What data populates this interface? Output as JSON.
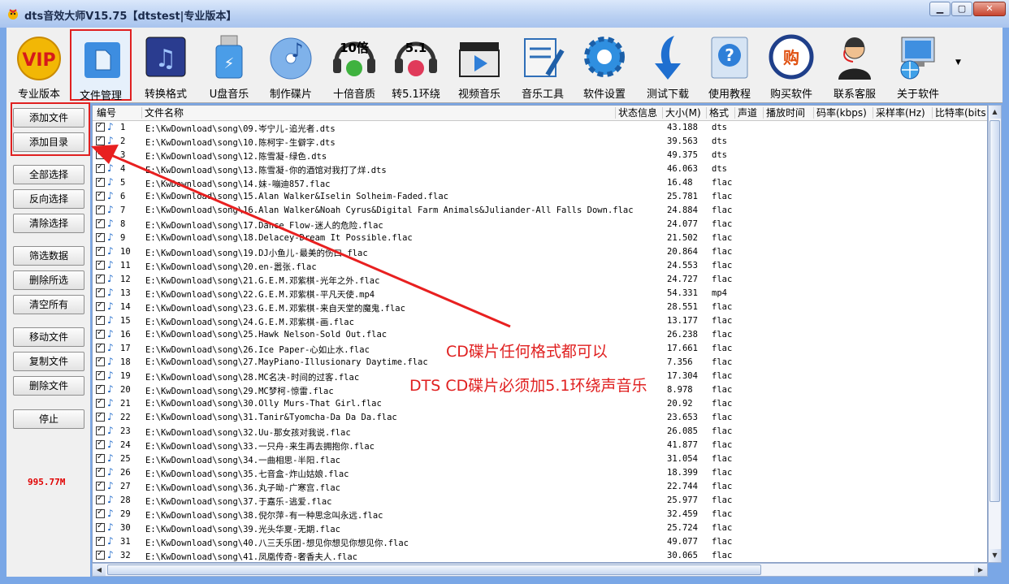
{
  "window": {
    "title": "dts音效大师V15.75【dtstest|专业版本】",
    "min_glyph": "▁",
    "max_glyph": "▢",
    "close_glyph": "✕"
  },
  "toolbar": {
    "items": [
      {
        "label": "专业版本",
        "icon": "vip-icon"
      },
      {
        "label": "文件管理",
        "icon": "file-manage-icon",
        "active": true
      },
      {
        "label": "转换格式",
        "icon": "convert-icon"
      },
      {
        "label": "U盘音乐",
        "icon": "usb-icon"
      },
      {
        "label": "制作碟片",
        "icon": "disc-icon"
      },
      {
        "label": "十倍音质",
        "icon": "ten-x-icon",
        "badge": "10倍"
      },
      {
        "label": "转5.1环绕",
        "icon": "surround-icon",
        "badge": "5.1"
      },
      {
        "label": "视频音乐",
        "icon": "video-icon"
      },
      {
        "label": "音乐工具",
        "icon": "tools-icon"
      },
      {
        "label": "软件设置",
        "icon": "gear-icon"
      },
      {
        "label": "测试下载",
        "icon": "download-icon"
      },
      {
        "label": "使用教程",
        "icon": "help-icon"
      },
      {
        "label": "购买软件",
        "icon": "buy-icon",
        "badge": "购"
      },
      {
        "label": "联系客服",
        "icon": "support-icon"
      },
      {
        "label": "关于软件",
        "icon": "about-icon"
      }
    ],
    "more_glyph": "▼"
  },
  "sidebar": {
    "buttons": [
      "添加文件",
      "添加目录",
      "全部选择",
      "反向选择",
      "清除选择",
      "筛选数据",
      "删除所选",
      "清空所有",
      "移动文件",
      "复制文件",
      "删除文件",
      "停止"
    ],
    "speed": "995.77M"
  },
  "table": {
    "columns": [
      "编号",
      "文件名称",
      "状态信息",
      "大小(M)",
      "格式",
      "声道",
      "播放时间",
      "码率(kbps)",
      "采样率(Hz)",
      "比特率(bits"
    ],
    "rows": [
      {
        "n": "1",
        "path": "E:\\KwDownload\\song\\09.岑宁儿-追光者.dts",
        "size": "43.188",
        "fmt": "dts"
      },
      {
        "n": "2",
        "path": "E:\\KwDownload\\song\\10.陈柯宇-生僻字.dts",
        "size": "39.563",
        "fmt": "dts"
      },
      {
        "n": "3",
        "path": "E:\\KwDownload\\song\\12.陈雪凝-绿色.dts",
        "size": "49.375",
        "fmt": "dts"
      },
      {
        "n": "4",
        "path": "E:\\KwDownload\\song\\13.陈雪凝-你的酒馆对我打了烊.dts",
        "size": "46.063",
        "fmt": "dts"
      },
      {
        "n": "5",
        "path": "E:\\KwDownload\\song\\14.妹-嘣迪857.flac",
        "size": "16.48",
        "fmt": "flac"
      },
      {
        "n": "6",
        "path": "E:\\KwDownload\\song\\15.Alan Walker&Iselin Solheim-Faded.flac",
        "size": "25.781",
        "fmt": "flac"
      },
      {
        "n": "7",
        "path": "E:\\KwDownload\\song\\16.Alan Walker&Noah Cyrus&Digital Farm Animals&Juliander-All Falls Down.flac",
        "size": "24.884",
        "fmt": "flac"
      },
      {
        "n": "8",
        "path": "E:\\KwDownload\\song\\17.Dance Flow-迷人的危险.flac",
        "size": "24.077",
        "fmt": "flac"
      },
      {
        "n": "9",
        "path": "E:\\KwDownload\\song\\18.Delacey-Dream It Possible.flac",
        "size": "21.502",
        "fmt": "flac"
      },
      {
        "n": "10",
        "path": "E:\\KwDownload\\song\\19.DJ小鱼儿-最美的伤口.flac",
        "size": "20.864",
        "fmt": "flac"
      },
      {
        "n": "11",
        "path": "E:\\KwDownload\\song\\20.en-嚣张.flac",
        "size": "24.553",
        "fmt": "flac"
      },
      {
        "n": "12",
        "path": "E:\\KwDownload\\song\\21.G.E.M.邓紫棋-光年之外.flac",
        "size": "24.727",
        "fmt": "flac"
      },
      {
        "n": "13",
        "path": "E:\\KwDownload\\song\\22.G.E.M.邓紫棋-平凡天使.mp4",
        "size": "54.331",
        "fmt": "mp4"
      },
      {
        "n": "14",
        "path": "E:\\KwDownload\\song\\23.G.E.M.邓紫棋-来自天堂的魔鬼.flac",
        "size": "28.551",
        "fmt": "flac"
      },
      {
        "n": "15",
        "path": "E:\\KwDownload\\song\\24.G.E.M.邓紫棋-画.flac",
        "size": "13.177",
        "fmt": "flac"
      },
      {
        "n": "16",
        "path": "E:\\KwDownload\\song\\25.Hawk Nelson-Sold Out.flac",
        "size": "26.238",
        "fmt": "flac"
      },
      {
        "n": "17",
        "path": "E:\\KwDownload\\song\\26.Ice Paper-心如止水.flac",
        "size": "17.661",
        "fmt": "flac"
      },
      {
        "n": "18",
        "path": "E:\\KwDownload\\song\\27.MayPiano-Illusionary Daytime.flac",
        "size": "7.356",
        "fmt": "flac"
      },
      {
        "n": "19",
        "path": "E:\\KwDownload\\song\\28.MC名决-时间的过客.flac",
        "size": "17.304",
        "fmt": "flac"
      },
      {
        "n": "20",
        "path": "E:\\KwDownload\\song\\29.MC梦柯-惊雷.flac",
        "size": "8.978",
        "fmt": "flac"
      },
      {
        "n": "21",
        "path": "E:\\KwDownload\\song\\30.Olly Murs-That Girl.flac",
        "size": "20.92",
        "fmt": "flac"
      },
      {
        "n": "22",
        "path": "E:\\KwDownload\\song\\31.Tanir&Tyomcha-Da Da Da.flac",
        "size": "23.653",
        "fmt": "flac"
      },
      {
        "n": "23",
        "path": "E:\\KwDownload\\song\\32.Uu-那女孩对我说.flac",
        "size": "26.085",
        "fmt": "flac"
      },
      {
        "n": "24",
        "path": "E:\\KwDownload\\song\\33.一只舟-来生再去拥抱你.flac",
        "size": "41.877",
        "fmt": "flac"
      },
      {
        "n": "25",
        "path": "E:\\KwDownload\\song\\34.一曲相思-半阳.flac",
        "size": "31.054",
        "fmt": "flac"
      },
      {
        "n": "26",
        "path": "E:\\KwDownload\\song\\35.七音盒-炸山姑娘.flac",
        "size": "18.399",
        "fmt": "flac"
      },
      {
        "n": "27",
        "path": "E:\\KwDownload\\song\\36.丸子呦-广寒宫.flac",
        "size": "22.744",
        "fmt": "flac"
      },
      {
        "n": "28",
        "path": "E:\\KwDownload\\song\\37.于嘉乐-逃爱.flac",
        "size": "25.977",
        "fmt": "flac"
      },
      {
        "n": "29",
        "path": "E:\\KwDownload\\song\\38.倪尔萍-有一种思念叫永远.flac",
        "size": "32.459",
        "fmt": "flac"
      },
      {
        "n": "30",
        "path": "E:\\KwDownload\\song\\39.光头华夏-无期.flac",
        "size": "25.724",
        "fmt": "flac"
      },
      {
        "n": "31",
        "path": "E:\\KwDownload\\song\\40.八三夭乐团-想见你想见你想见你.flac",
        "size": "49.077",
        "fmt": "flac"
      },
      {
        "n": "32",
        "path": "E:\\KwDownload\\song\\41.凤凰传奇-奢香夫人.flac",
        "size": "30.065",
        "fmt": "flac"
      }
    ]
  },
  "annotations": {
    "line1": "CD碟片任何格式都可以",
    "line2": "DTS CD碟片必须加5.1环绕声音乐",
    "color": "#e02020"
  },
  "scroll": {
    "up": "▲",
    "down": "▼",
    "left": "◀",
    "right": "▶"
  }
}
